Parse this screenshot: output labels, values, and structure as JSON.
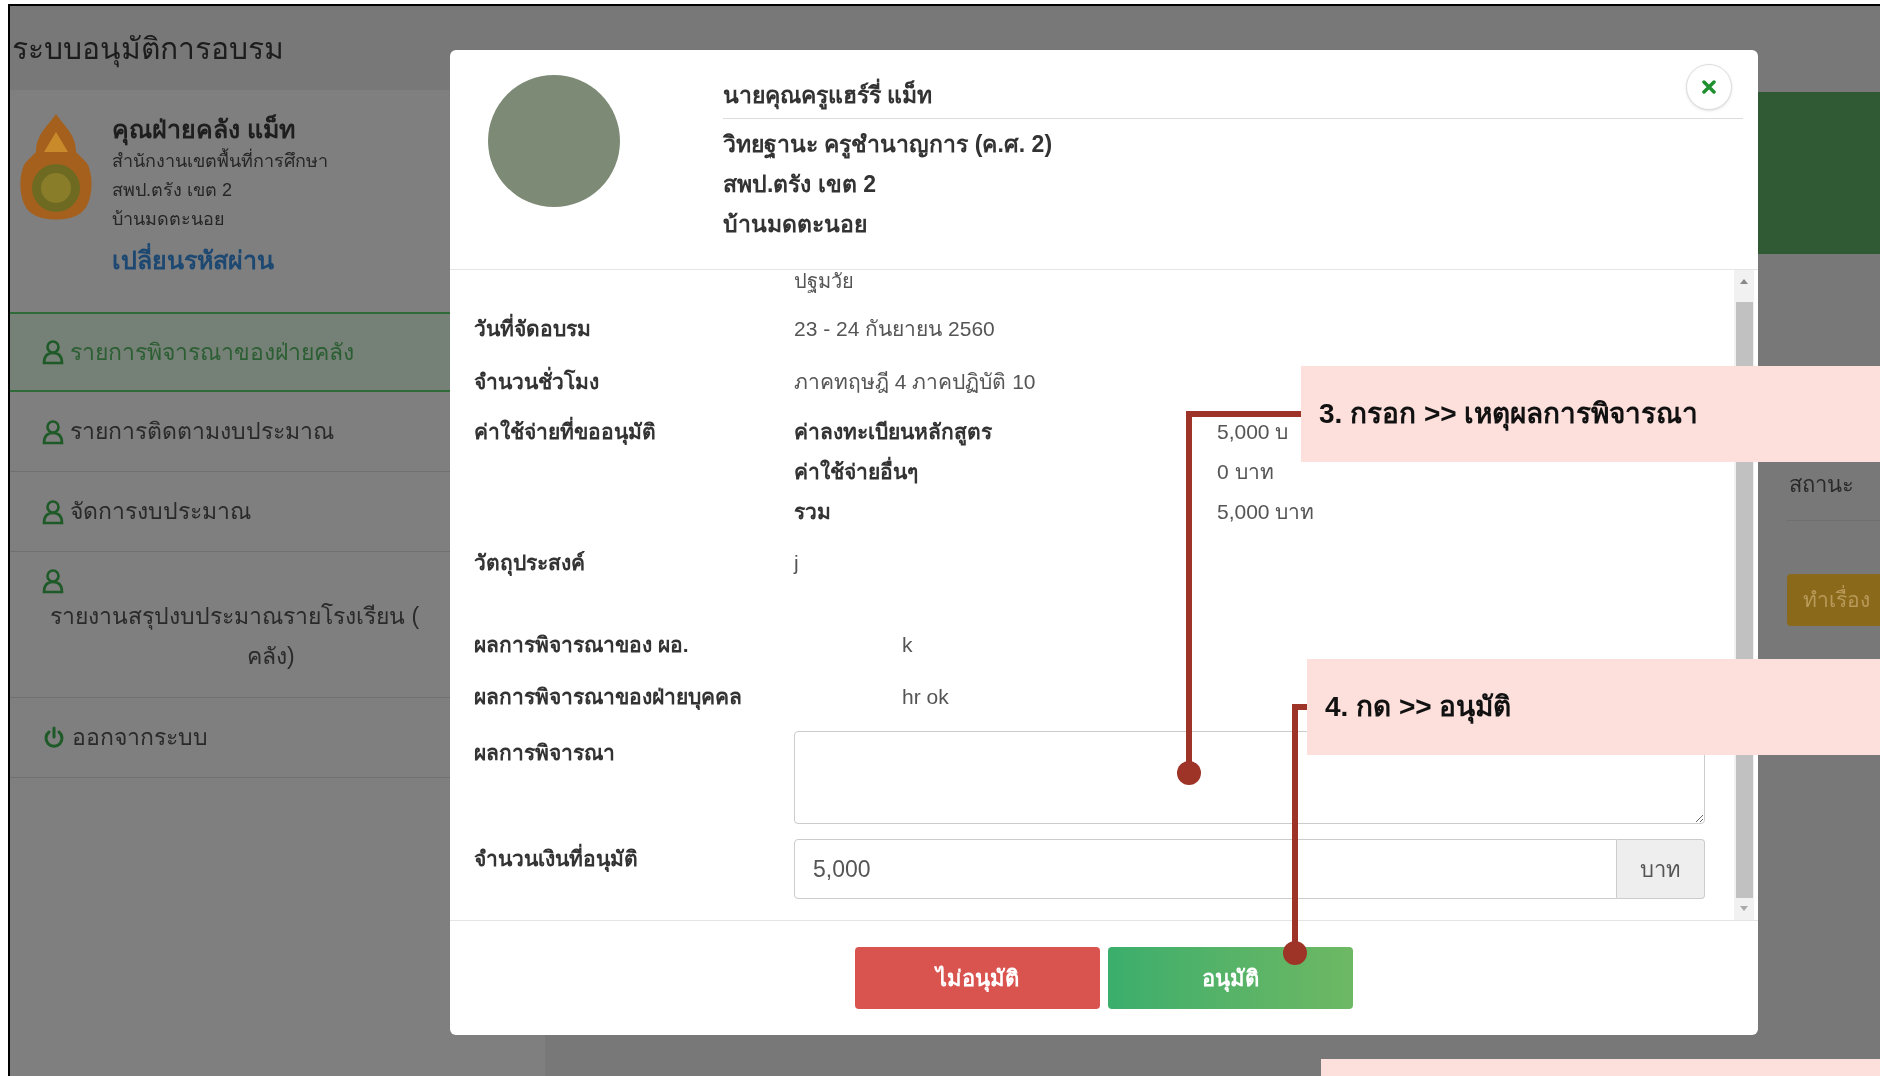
{
  "app_title": "ระบบอนุมัติการอบรม",
  "user_card": {
    "name": "คุณฝ่ายคลัง แม็ท",
    "office": "สำนักงานเขตพื้นที่การศึกษา",
    "area": "สพป.ตรัง เขต 2",
    "school": "บ้านมดตะนอย",
    "change_password": "เปลี่ยนรหัสผ่าน"
  },
  "sidebar": {
    "items": [
      {
        "label": "รายการพิจารณาของฝ่ายคลัง",
        "kind": "user",
        "selected": true
      },
      {
        "label": "รายการติดตามงบประมาณ",
        "kind": "user",
        "selected": false
      },
      {
        "label": "จัดการงบประมาณ",
        "kind": "user",
        "selected": false
      },
      {
        "label": "รายงานสรุปงบประมาณรายโรงเรียน (",
        "label_line_2": "คลัง)",
        "kind": "user-stacked",
        "selected": false
      },
      {
        "label": "ออกจากระบบ",
        "kind": "power",
        "selected": false
      }
    ]
  },
  "background": {
    "status_header": "สถานะ",
    "action_button": "ทำเรื่อง"
  },
  "modal": {
    "header": {
      "name": "นายคุณครูแฮร์รี่ แม็ท",
      "rank": "วิทยฐานะ ครูชำนาญการ (ค.ศ. 2)",
      "area": "สพป.ตรัง เขต 2",
      "school": "บ้านมดตะนอย"
    },
    "scrolled_value": "ปฐมวัย",
    "details": [
      {
        "kind": "text",
        "label": "วันที่จัดอบรม",
        "value": "23 - 24 กันยายน 2560"
      },
      {
        "kind": "text",
        "label": "จำนวนชั่วโมง",
        "value": "ภาคทฤษฎี 4 ภาคปฏิบัติ 10"
      },
      {
        "kind": "expenses",
        "label": "ค่าใช้จ่ายที่ขออนุมัติ",
        "items": [
          {
            "label": "ค่าลงทะเบียนหลักสูตร",
            "amount": "5,000 บ"
          },
          {
            "label": "ค่าใช้จ่ายอื่นๆ",
            "amount": "0 บาท"
          },
          {
            "label": "รวม",
            "amount": "5,000 บาท"
          }
        ]
      },
      {
        "kind": "text",
        "label": "วัตถุประสงค์",
        "value": "j"
      }
    ],
    "reviews": [
      {
        "label": "ผลการพิจารณาของ ผอ.",
        "value": "k"
      },
      {
        "label": "ผลการพิจารณาของฝ่ายบุคคล",
        "value": "hr ok"
      }
    ],
    "decision_field": {
      "label": "ผลการพิจารณา"
    },
    "amount_field": {
      "label": "จำนวนเงินที่อนุมัติ",
      "value": "5,000",
      "unit": "บาท"
    },
    "buttons": [
      {
        "label": "ไม่อนุมัติ",
        "kind": "danger"
      },
      {
        "label": "อนุมัติ",
        "kind": "success"
      }
    ]
  },
  "annotations": [
    {
      "text": "3. กรอก >> เหตุผลการพิจารณา"
    },
    {
      "text": "4. กด >> อนุมัติ"
    }
  ]
}
